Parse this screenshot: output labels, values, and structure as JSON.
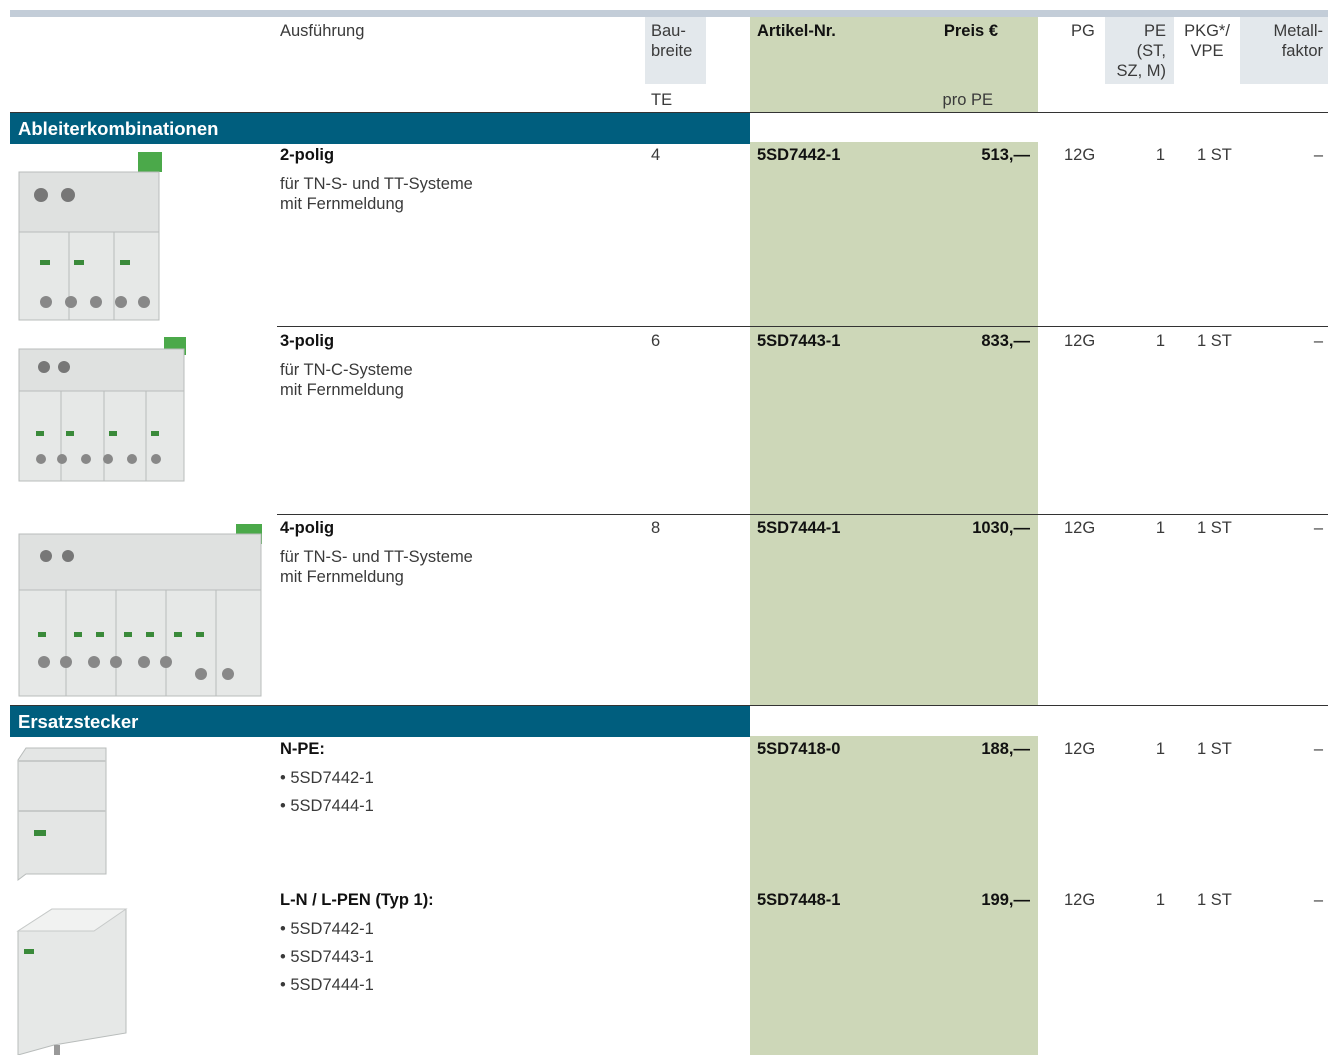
{
  "header": {
    "ausfuehrung": "Ausführung",
    "baubreite": "Bau-\nbreite",
    "te": "TE",
    "artikel": "Artikel-Nr.",
    "preis": "Preis €",
    "pro_pe": "pro PE",
    "pg": "PG",
    "pe": "PE\n(ST,\nSZ, M)",
    "pkg": "PKG*/\nVPE",
    "metall": "Metall-\nfaktor"
  },
  "sections": [
    {
      "title": "Ableiterkombinationen",
      "rows": [
        {
          "name": "2-polig",
          "desc1": "für TN-S- und TT-Systeme",
          "desc2": "mit Fernmeldung",
          "te": "4",
          "artikel": "5SD7442-1",
          "preis": "513,—",
          "pg": "12G",
          "pe": "1",
          "pkg": "1 ST",
          "metall": "–"
        },
        {
          "name": "3-polig",
          "desc1": "für TN-C-Systeme",
          "desc2": "mit Fernmeldung",
          "te": "6",
          "artikel": "5SD7443-1",
          "preis": "833,—",
          "pg": "12G",
          "pe": "1",
          "pkg": "1 ST",
          "metall": "–"
        },
        {
          "name": "4-polig",
          "desc1": "für TN-S- und TT-Systeme",
          "desc2": "mit Fernmeldung",
          "te": "8",
          "artikel": "5SD7444-1",
          "preis": "1030,—",
          "pg": "12G",
          "pe": "1",
          "pkg": "1 ST",
          "metall": "–"
        }
      ]
    },
    {
      "title": "Ersatzstecker",
      "rows": [
        {
          "name": "N-PE:",
          "bullets": [
            "5SD7442-1",
            "5SD7444-1"
          ],
          "artikel": "5SD7418-0",
          "preis": "188,—",
          "pg": "12G",
          "pe": "1",
          "pkg": "1 ST",
          "metall": "–"
        },
        {
          "name": "L-N / L-PEN (Typ 1):",
          "bullets": [
            "5SD7442-1",
            "5SD7443-1",
            "5SD7444-1"
          ],
          "artikel": "5SD7448-1",
          "preis": "199,—",
          "pg": "12G",
          "pe": "1",
          "pkg": "1 ST",
          "metall": "–"
        }
      ]
    }
  ]
}
